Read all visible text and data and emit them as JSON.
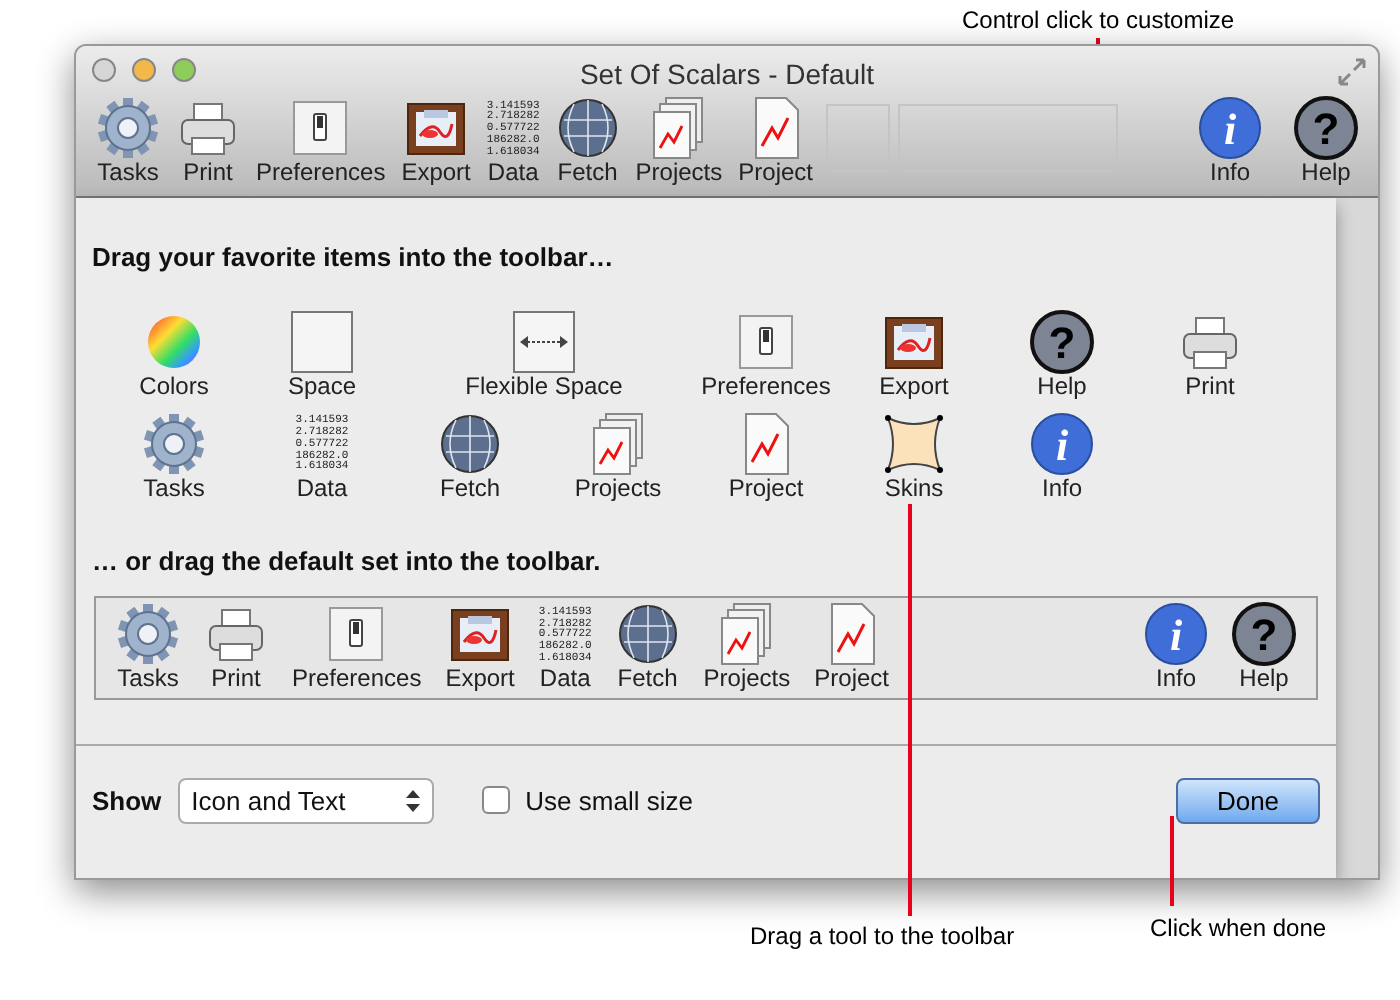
{
  "annotations": [
    {
      "kind": "top",
      "text": "Control click to customize"
    },
    {
      "kind": "drag",
      "text": "Drag a tool to the toolbar"
    },
    {
      "kind": "done",
      "text": "Click when done"
    }
  ],
  "window": {
    "title": "Set Of Scalars - Default"
  },
  "toolbar": {
    "left": [
      {
        "kind": "gear",
        "label": "Tasks"
      },
      {
        "kind": "printer",
        "label": "Print"
      },
      {
        "kind": "switch",
        "label": "Preferences"
      },
      {
        "kind": "picture",
        "label": "Export"
      },
      {
        "kind": "numbers",
        "label": "Data",
        "lines": [
          "3.141593",
          "2.718282",
          "0.577722",
          "186282.0",
          "1.618034"
        ]
      },
      {
        "kind": "globe",
        "label": "Fetch"
      },
      {
        "kind": "docs",
        "label": "Projects"
      },
      {
        "kind": "doc",
        "label": "Project"
      }
    ],
    "right": [
      {
        "kind": "info",
        "label": "Info",
        "glyph": "i"
      },
      {
        "kind": "help",
        "label": "Help",
        "glyph": "?"
      }
    ]
  },
  "sheet": {
    "palette_heading": "Drag your favorite items into the toolbar…",
    "palette": [
      {
        "kind": "colors",
        "label": "Colors"
      },
      {
        "kind": "space",
        "label": "Space"
      },
      {
        "kind": "flex",
        "label": "Flexible Space"
      },
      {
        "kind": "switch",
        "label": "Preferences"
      },
      {
        "kind": "picture",
        "label": "Export"
      },
      {
        "kind": "help",
        "label": "Help",
        "glyph": "?"
      },
      {
        "kind": "printer",
        "label": "Print"
      },
      {
        "kind": "gear",
        "label": "Tasks"
      },
      {
        "kind": "numbers",
        "label": "Data",
        "lines": [
          "3.141593",
          "2.718282",
          "0.577722",
          "186282.0",
          "1.618034"
        ]
      },
      {
        "kind": "globe",
        "label": "Fetch"
      },
      {
        "kind": "docs",
        "label": "Projects"
      },
      {
        "kind": "doc",
        "label": "Project"
      },
      {
        "kind": "skins",
        "label": "Skins"
      },
      {
        "kind": "info",
        "label": "Info",
        "glyph": "i"
      }
    ],
    "default_heading": "… or drag the default set into the toolbar.",
    "default_set": {
      "left": [
        {
          "kind": "gear",
          "label": "Tasks"
        },
        {
          "kind": "printer",
          "label": "Print"
        },
        {
          "kind": "switch",
          "label": "Preferences"
        },
        {
          "kind": "picture",
          "label": "Export"
        },
        {
          "kind": "numbers",
          "label": "Data",
          "lines": [
            "3.141593",
            "2.718282",
            "0.577722",
            "186282.0",
            "1.618034"
          ]
        },
        {
          "kind": "globe",
          "label": "Fetch"
        },
        {
          "kind": "docs",
          "label": "Projects"
        },
        {
          "kind": "doc",
          "label": "Project"
        }
      ],
      "right": [
        {
          "kind": "info",
          "label": "Info",
          "glyph": "i"
        },
        {
          "kind": "help",
          "label": "Help",
          "glyph": "?"
        }
      ]
    },
    "show_label": "Show",
    "show_value": "Icon and Text",
    "small_size": {
      "label": "Use small size",
      "checked": false
    },
    "done_button": "Done"
  }
}
